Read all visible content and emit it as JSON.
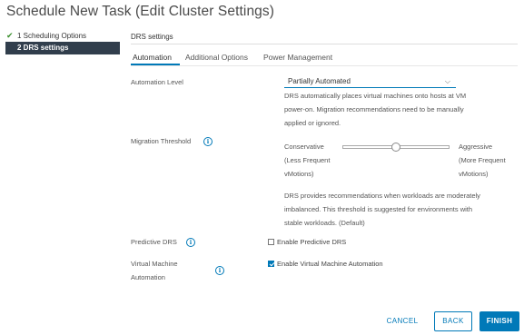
{
  "window": {
    "title": "Schedule New Task (Edit Cluster Settings)"
  },
  "steps": [
    {
      "label": "1 Scheduling Options",
      "status": "completed",
      "icon": "check-icon"
    },
    {
      "label": "2 DRS settings",
      "status": "active"
    }
  ],
  "section": {
    "title": "DRS settings"
  },
  "tabs": [
    {
      "label": "Automation",
      "active": true
    },
    {
      "label": "Additional Options",
      "active": false
    },
    {
      "label": "Power Management",
      "active": false
    }
  ],
  "automation_level": {
    "label": "Automation Level",
    "value": "Partially Automated",
    "description_lines": [
      "DRS automatically places virtual machines onto hosts at VM",
      "power-on. Migration recommendations need to be manually",
      "applied or ignored."
    ]
  },
  "migration_threshold": {
    "label": "Migration Threshold",
    "left_lines": [
      "Conservative",
      "(Less Frequent",
      "vMotions)"
    ],
    "right_lines": [
      "Aggressive",
      "(More Frequent",
      "vMotions)"
    ],
    "slider_level_fraction": 0.5,
    "description_lines": [
      "DRS provides recommendations when workloads are moderately",
      "imbalanced. This threshold is suggested for environments with",
      "stable workloads. (Default)"
    ]
  },
  "predictive_drs": {
    "label": "Predictive DRS",
    "checkbox_label": "Enable Predictive DRS",
    "checked": false
  },
  "vm_automation": {
    "label_lines": [
      "Virtual Machine",
      "Automation"
    ],
    "checkbox_label": "Enable Virtual Machine Automation",
    "checked": true
  },
  "buttons": {
    "cancel": "CANCEL",
    "back": "BACK",
    "finish": "FINISH"
  },
  "colors": {
    "accent": "#0079b8",
    "active_step_bg": "#313e4c",
    "check": "#3a8f2d"
  }
}
